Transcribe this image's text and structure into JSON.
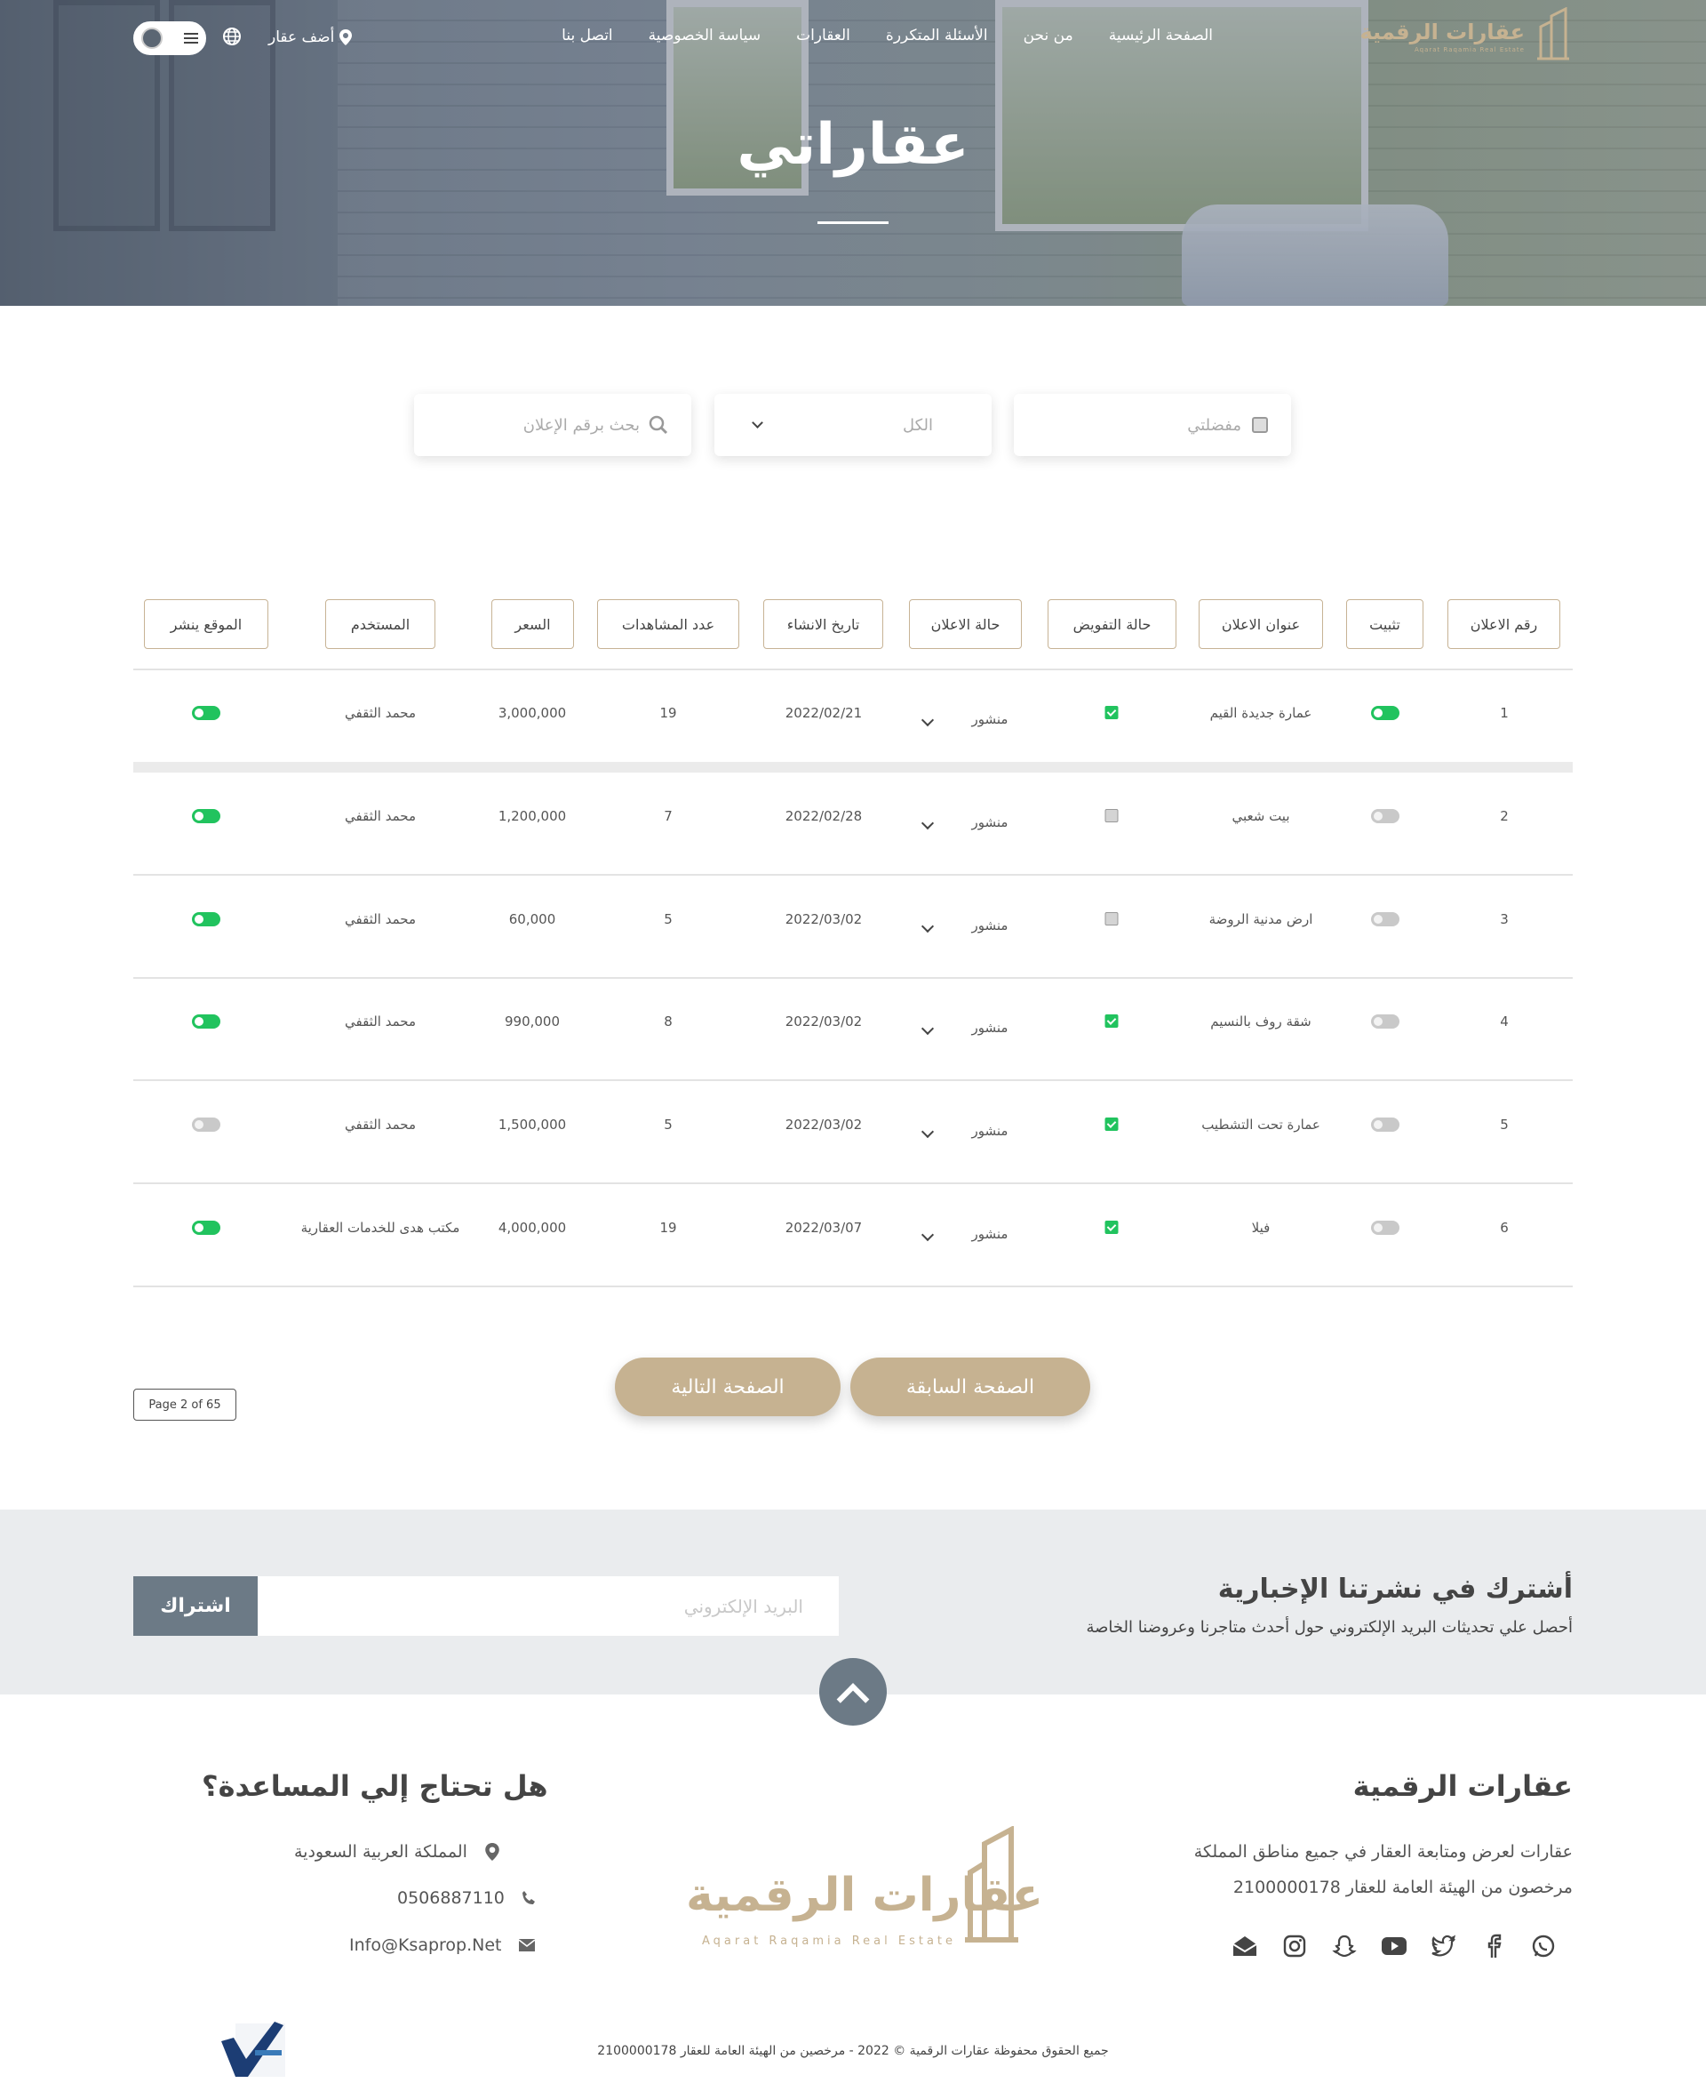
{
  "header": {
    "logo_text": "عقارات الرقمية",
    "logo_sub": "Aqarat Raqamia Real Estate",
    "nav": [
      "الصفحة الرئيسية",
      "من نحن",
      "الأسئلة المتكررة",
      "العقارات",
      "سياسة الخصوصية",
      "اتصل بنا"
    ],
    "add_property": "أضف عقار",
    "page_title": "عقاراتي"
  },
  "filters": {
    "favorites_label": "مفضلتي",
    "status_select": "الكل",
    "search_placeholder": "بحث برقم الإعلان"
  },
  "table": {
    "columns": [
      "رقم الاعلان",
      "تثبيت",
      "عنوان الاعلان",
      "حالة التفويض",
      "حالة الاعلان",
      "تاريخ الانشاء",
      "عدد المشاهدات",
      "السعر",
      "المستخدم",
      "الموقع ينشر"
    ],
    "rows": [
      {
        "id": "1",
        "pinned": true,
        "title": "عمارة جديدة القيم",
        "authorized": true,
        "status": "منشور",
        "created": "2022/02/21",
        "views": "19",
        "price": "3,000,000",
        "user": "محمد الثقفي",
        "published": true
      },
      {
        "id": "2",
        "pinned": false,
        "title": "بيت شعبي",
        "authorized": false,
        "status": "منشور",
        "created": "2022/02/28",
        "views": "7",
        "price": "1,200,000",
        "user": "محمد الثقفي",
        "published": true
      },
      {
        "id": "3",
        "pinned": false,
        "title": "ارض مدنية الروضة",
        "authorized": false,
        "status": "منشور",
        "created": "2022/03/02",
        "views": "5",
        "price": "60,000",
        "user": "محمد الثقفي",
        "published": true
      },
      {
        "id": "4",
        "pinned": false,
        "title": "شقة روف بالنسيم",
        "authorized": true,
        "status": "منشور",
        "created": "2022/03/02",
        "views": "8",
        "price": "990,000",
        "user": "محمد الثقفي",
        "published": true
      },
      {
        "id": "5",
        "pinned": false,
        "title": "عمارة تحت التشطيب",
        "authorized": true,
        "status": "منشور",
        "created": "2022/03/02",
        "views": "5",
        "price": "1,500,000",
        "user": "محمد الثقفي",
        "published": false
      },
      {
        "id": "6",
        "pinned": false,
        "title": "فيلا",
        "authorized": true,
        "status": "منشور",
        "created": "2022/03/07",
        "views": "19",
        "price": "4,000,000",
        "user": "مكتب هدى للخدمات العقارية",
        "published": true
      }
    ]
  },
  "pagination": {
    "prev": "الصفحة السابقة",
    "next": "الصفحة التالية",
    "info": "Page 2 of 65"
  },
  "newsletter": {
    "title": "أشترك في نشرتنا الإخبارية",
    "subtitle": "أحصل علي تحديثات البريد الإلكتروني حول أحدث متاجرنا وعروضنا الخاصة",
    "email_placeholder": "البريد الإلكتروني",
    "subscribe": "اشتراك"
  },
  "footer": {
    "brand_title": "عقارات الرقمية",
    "brand_line1": "عقارات لعرض ومتابعة العقار في جميع مناطق المملكة",
    "brand_line2": "مرخصون من الهيئة العامة للعقار 2100000178",
    "logo_text": "عقارات الرقمية",
    "logo_sub": "Aqarat Raqamia Real Estate",
    "help_title": "هل تحتاج إلي المساعدة؟",
    "address": "المملكة العربية السعودية",
    "phone": "0506887110",
    "email": "Info@Ksaprop.Net",
    "copyright": "جميع الحقوق محفوظة عقارات الرقمية © 2022 - مرخصين من الهيئة العامة للعقار 2100000178",
    "social": [
      "whatsapp-icon",
      "facebook-icon",
      "twitter-icon",
      "youtube-icon",
      "snapchat-icon",
      "instagram-icon",
      "mail-open-icon"
    ]
  },
  "colors": {
    "accent": "#c6b291",
    "slate": "#6c7a86",
    "toggle_on": "#21c35e"
  }
}
